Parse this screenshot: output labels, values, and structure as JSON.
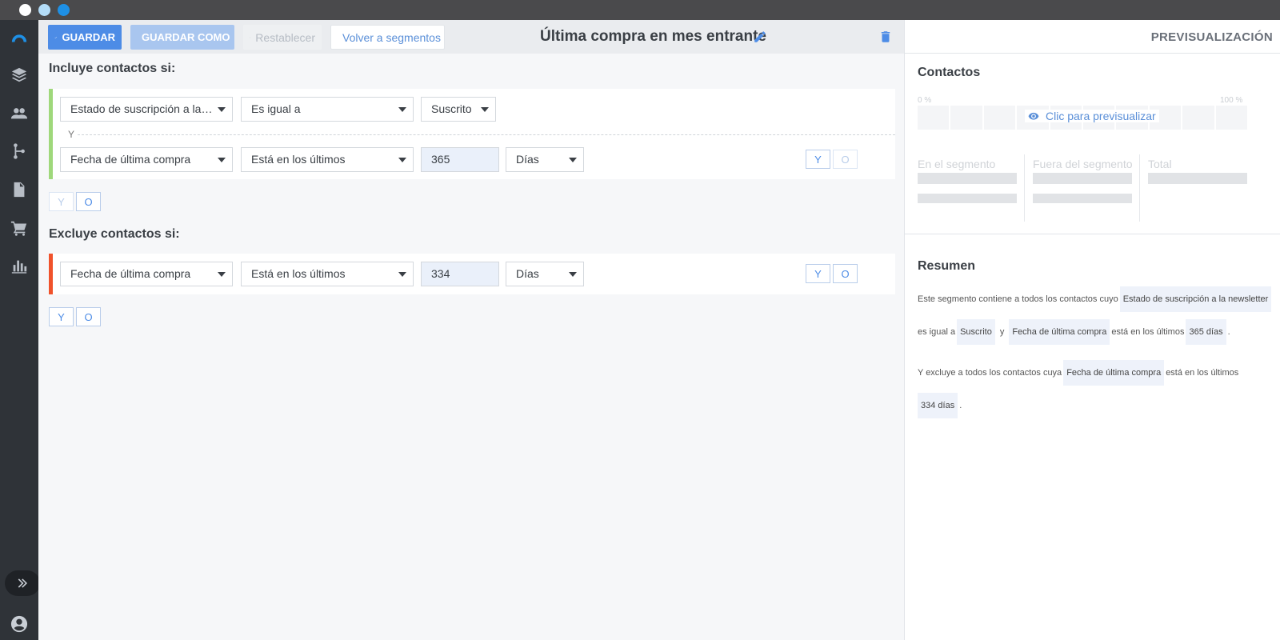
{
  "window": {
    "title": ""
  },
  "sidebar": {
    "items": [
      {
        "icon": "logo-icon"
      },
      {
        "icon": "layers-icon"
      },
      {
        "icon": "contacts-icon"
      },
      {
        "icon": "flow-icon"
      },
      {
        "icon": "document-icon"
      },
      {
        "icon": "cart-icon"
      },
      {
        "icon": "chart-icon"
      }
    ],
    "expand_icon": "double-chevron-right-icon",
    "user_icon": "user-account-icon"
  },
  "toolbar": {
    "save_label": "GUARDAR",
    "save_as_label": "GUARDAR COMO",
    "reset_label": "Restablecer",
    "back_label": "Volver a segmentos",
    "segment_title": "Última compra en mes entrante"
  },
  "include": {
    "title": "Incluye contactos si:",
    "rules": [
      {
        "field": "Estado de suscripción a la newsletter",
        "operator": "Es igual a",
        "value": "Suscrito"
      },
      {
        "field": "Fecha de última compra",
        "operator": "Está en los últimos",
        "value": "365",
        "unit": "Días"
      }
    ],
    "joiner": "Y",
    "and_label": "Y",
    "or_label": "O"
  },
  "exclude": {
    "title": "Excluye contactos si:",
    "rules": [
      {
        "field": "Fecha de última compra",
        "operator": "Está en los últimos",
        "value": "334",
        "unit": "Días"
      }
    ],
    "and_label": "Y",
    "or_label": "O"
  },
  "preview": {
    "header": "PREVISUALIZACIÓN",
    "contacts_title": "Contactos",
    "pct_min": "0 %",
    "pct_max": "100 %",
    "preview_link": "Clic para previsualizar",
    "stats": [
      "En el segmento",
      "Fuera del segmento",
      "Total"
    ],
    "summary_title": "Resumen",
    "summary": {
      "l1_text": "Este segmento contiene a todos los contactos cuyo",
      "l1_chip": "Estado de suscripción a la newsletter",
      "l2_text1": "es igual a",
      "l2_chip1": "Suscrito",
      "l2_text2": "y",
      "l2_chip2": "Fecha de última compra",
      "l2_text3": "está en los últimos",
      "l2_chip3": "365 días",
      "l2_end": ".",
      "l3_text1": "Y excluye a todos los contactos cuya",
      "l3_chip": "Fecha de última compra",
      "l3_text2": "está en los últimos",
      "l4_chip": "334 días",
      "l4_end": "."
    }
  },
  "colors": {
    "accent_blue": "#4d8ce6",
    "include_bar": "#9fd87b",
    "exclude_bar": "#f0522b",
    "sidebar_bg": "#2f3338"
  }
}
